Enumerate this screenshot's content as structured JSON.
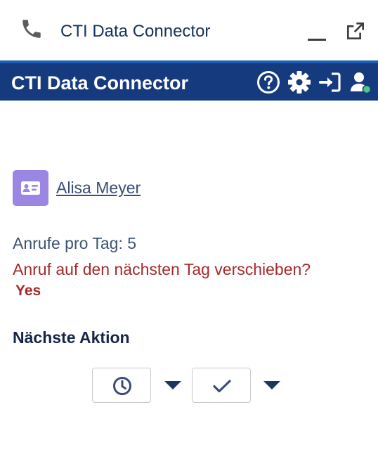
{
  "window": {
    "title": "CTI Data Connector",
    "icons": [
      "phone-icon",
      "minimize-icon",
      "popout-icon"
    ]
  },
  "header": {
    "title": "CTI Data Connector",
    "icons": [
      "help-icon",
      "gear-icon",
      "login-icon",
      "user-status-icon"
    ],
    "colors": {
      "background": "#163a7e",
      "accent": "#1b5fb7",
      "status_online": "#4bca81"
    }
  },
  "contact": {
    "icon": "contact-card-icon",
    "name": "Alisa Meyer",
    "avatar_color": "#9b86e3"
  },
  "info": {
    "calls_per_day": "Anrufe pro Tag: 5",
    "question": "Anruf auf den nächsten Tag verschieben?",
    "yes_label": "Yes"
  },
  "next_action": {
    "title": "Nächste Aktion",
    "buttons": [
      {
        "icon": "clock-icon"
      },
      {
        "icon": "checkmark-icon"
      }
    ]
  }
}
